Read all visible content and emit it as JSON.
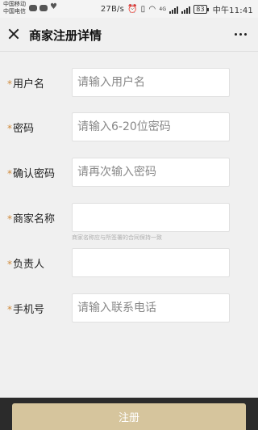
{
  "status_bar": {
    "carrier_1": "中国移动",
    "carrier_2": "中国电信",
    "speed": "27B/s",
    "network": "4G",
    "battery": "83",
    "time": "中午11:41"
  },
  "header": {
    "title": "商家注册详情"
  },
  "form": {
    "fields": [
      {
        "label": "用户名",
        "required": true,
        "placeholder": "请输入用户名"
      },
      {
        "label": "密码",
        "required": true,
        "placeholder": "请输入6-20位密码"
      },
      {
        "label": "确认密码",
        "required": true,
        "placeholder": "请再次输入密码"
      },
      {
        "label": "商家名称",
        "required": true,
        "placeholder": "",
        "hint": "商家名称应与所签署的合同保持一致"
      },
      {
        "label": "负责人",
        "required": true,
        "placeholder": ""
      },
      {
        "label": "手机号",
        "required": true,
        "placeholder": "请输入联系电话"
      }
    ],
    "required_mark": "*"
  },
  "actions": {
    "register_label": "注册"
  },
  "colors": {
    "required_mark": "#d08a3a",
    "button_bg": "#d6c59d",
    "bottom_bar": "#2b2b2b"
  }
}
